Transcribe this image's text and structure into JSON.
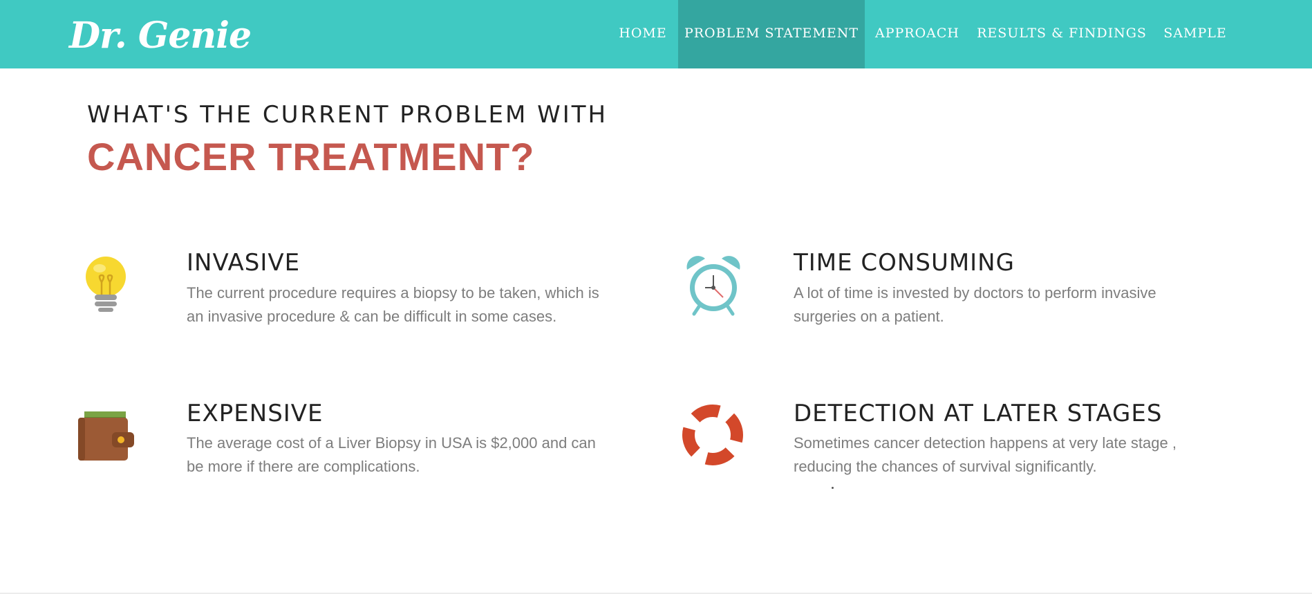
{
  "brand": "Dr. Genie",
  "nav": {
    "items": [
      {
        "label": "HOME"
      },
      {
        "label": "PROBLEM STATEMENT"
      },
      {
        "label": "APPROACH"
      },
      {
        "label": "RESULTS & FINDINGS"
      },
      {
        "label": "SAMPLE"
      }
    ],
    "active": "PROBLEM STATEMENT"
  },
  "section": {
    "subtitle": "WHAT'S THE CURRENT PROBLEM WITH",
    "title": "CANCER TREATMENT?"
  },
  "features": [
    {
      "icon": "lightbulb-icon",
      "title": "INVASIVE",
      "text": "The current procedure requires a biopsy to be taken, which is an invasive procedure & can be difficult in some cases."
    },
    {
      "icon": "alarm-clock-icon",
      "title": "TIME CONSUMING",
      "text": "A lot of time is invested by doctors to perform invasive surgeries on a patient."
    },
    {
      "icon": "wallet-icon",
      "title": "EXPENSIVE",
      "text": "The average cost of a Liver Biopsy in USA is $2,000 and can be more if there are complications."
    },
    {
      "icon": "lifebuoy-icon",
      "title": "DETECTION AT LATER STAGES",
      "text": "Sometimes cancer detection happens at very late stage , reducing the chances of survival significantly."
    }
  ],
  "colors": {
    "navbar": "#40c9c2",
    "nav_active": "#34a6a0",
    "title_accent": "#c5584f",
    "body_text": "#7d7d7d"
  }
}
